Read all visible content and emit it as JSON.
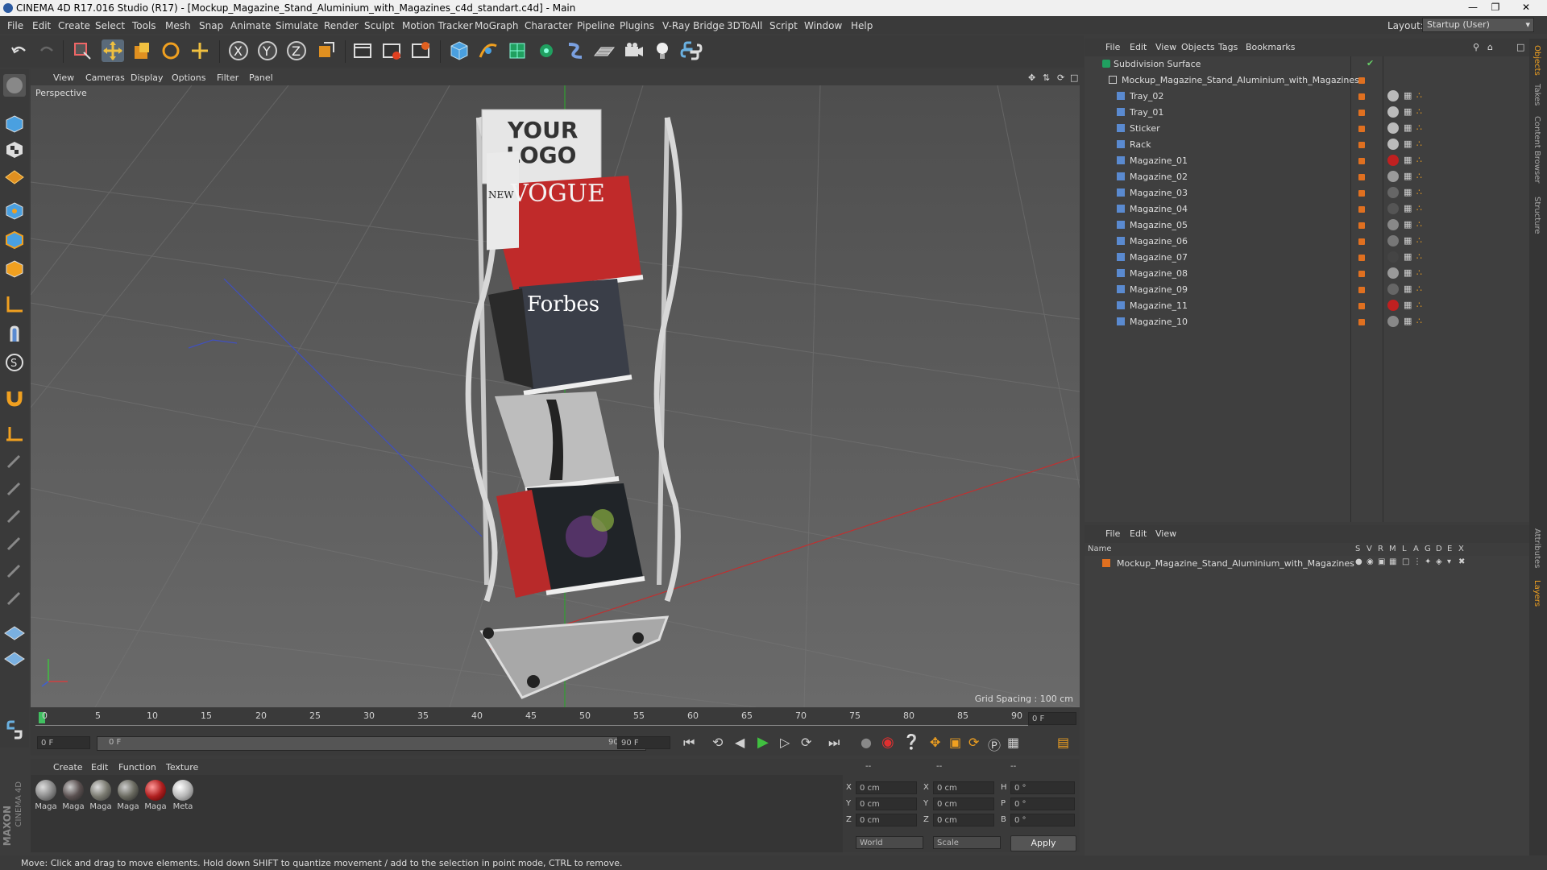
{
  "window": {
    "title": "CINEMA 4D R17.016 Studio (R17) - [Mockup_Magazine_Stand_Aluminium_with_Magazines_c4d_standart.c4d] - Main"
  },
  "menubar": {
    "items": [
      "File",
      "Edit",
      "Create",
      "Select",
      "Tools",
      "Mesh",
      "Snap",
      "Animate",
      "Simulate",
      "Render",
      "Sculpt",
      "Motion Tracker",
      "MoGraph",
      "Character",
      "Pipeline",
      "Plugins",
      "V-Ray Bridge",
      "3DToAll",
      "Script",
      "Window",
      "Help"
    ],
    "layout_label": "Layout:",
    "layout_value": "Startup (User)"
  },
  "viewport": {
    "menu": [
      "View",
      "Cameras",
      "Display",
      "Options",
      "Filter",
      "Panel"
    ],
    "camera_label": "Perspective",
    "grid_spacing": "Grid Spacing : 100 cm",
    "logo_line1": "YOUR",
    "logo_line2": "LOGO",
    "mag_vogue": "VOGUE",
    "mag_forbes": "Forbes",
    "mag_new": "NEW"
  },
  "timeline": {
    "ticks": [
      "0",
      "5",
      "10",
      "15",
      "20",
      "25",
      "30",
      "35",
      "40",
      "45",
      "50",
      "55",
      "60",
      "65",
      "70",
      "75",
      "80",
      "85",
      "90"
    ],
    "current_frame": "0 F",
    "start_field": "0 F",
    "range_start": "0 F",
    "range_end": "90 F",
    "end_field": "90 F"
  },
  "materials": {
    "menu": [
      "Create",
      "Edit",
      "Function",
      "Texture"
    ],
    "items": [
      {
        "label": "Maga",
        "color": "#8a8a8a"
      },
      {
        "label": "Maga",
        "color": "#5a5050"
      },
      {
        "label": "Maga",
        "color": "#7a7a70"
      },
      {
        "label": "Maga",
        "color": "#6a6a60"
      },
      {
        "label": "Maga",
        "color": "#b02020"
      },
      {
        "label": "Meta",
        "color": "#b8b8b8"
      }
    ]
  },
  "coordinates": {
    "headers": [
      "--",
      "--",
      "--"
    ],
    "rows": [
      {
        "a": "X",
        "v1": "0 cm",
        "b": "X",
        "v2": "0 cm",
        "c": "H",
        "v3": "0 °"
      },
      {
        "a": "Y",
        "v1": "0 cm",
        "b": "Y",
        "v2": "0 cm",
        "c": "P",
        "v3": "0 °"
      },
      {
        "a": "Z",
        "v1": "0 cm",
        "b": "Z",
        "v2": "0 cm",
        "c": "B",
        "v3": "0 °"
      }
    ],
    "mode1": "World",
    "mode2": "Scale",
    "apply": "Apply"
  },
  "objects": {
    "menu": [
      "File",
      "Edit",
      "View",
      "Objects",
      "Tags",
      "Bookmarks"
    ],
    "items": [
      {
        "name": "Subdivision Surface",
        "indent": 0,
        "tag": "#e8e8e8"
      },
      {
        "name": "Mockup_Magazine_Stand_Aluminium_with_Magazines",
        "indent": 1,
        "tag": ""
      },
      {
        "name": "Tray_02",
        "indent": 2,
        "tag": "#bbbbbb"
      },
      {
        "name": "Tray_01",
        "indent": 2,
        "tag": "#bbbbbb"
      },
      {
        "name": "Sticker",
        "indent": 2,
        "tag": "#bbbbbb"
      },
      {
        "name": "Rack",
        "indent": 2,
        "tag": "#bbbbbb"
      },
      {
        "name": "Magazine_01",
        "indent": 2,
        "tag": "#c02020"
      },
      {
        "name": "Magazine_02",
        "indent": 2,
        "tag": "#9a9a9a"
      },
      {
        "name": "Magazine_03",
        "indent": 2,
        "tag": "#666666"
      },
      {
        "name": "Magazine_04",
        "indent": 2,
        "tag": "#555555"
      },
      {
        "name": "Magazine_05",
        "indent": 2,
        "tag": "#888888"
      },
      {
        "name": "Magazine_06",
        "indent": 2,
        "tag": "#777777"
      },
      {
        "name": "Magazine_07",
        "indent": 2,
        "tag": "#444444"
      },
      {
        "name": "Magazine_08",
        "indent": 2,
        "tag": "#999999"
      },
      {
        "name": "Magazine_09",
        "indent": 2,
        "tag": "#666666"
      },
      {
        "name": "Magazine_11",
        "indent": 2,
        "tag": "#c02020"
      },
      {
        "name": "Magazine_10",
        "indent": 2,
        "tag": "#888888"
      }
    ]
  },
  "layers": {
    "menu": [
      "File",
      "Edit",
      "View"
    ],
    "columns": [
      "Name",
      "S",
      "V",
      "R",
      "M",
      "L",
      "A",
      "G",
      "D",
      "E",
      "X"
    ],
    "items": [
      {
        "name": "Mockup_Magazine_Stand_Aluminium_with_Magazines"
      }
    ]
  },
  "sidetabs": [
    "Objects",
    "Takes",
    "Content Browser",
    "Structure",
    "Attributes",
    "Layers"
  ],
  "status": {
    "text": "Move: Click and drag to move elements. Hold down SHIFT to quantize movement / add to the selection in point mode, CTRL to remove."
  },
  "brand": {
    "line1": "MAXON",
    "line2": "CINEMA 4D"
  }
}
